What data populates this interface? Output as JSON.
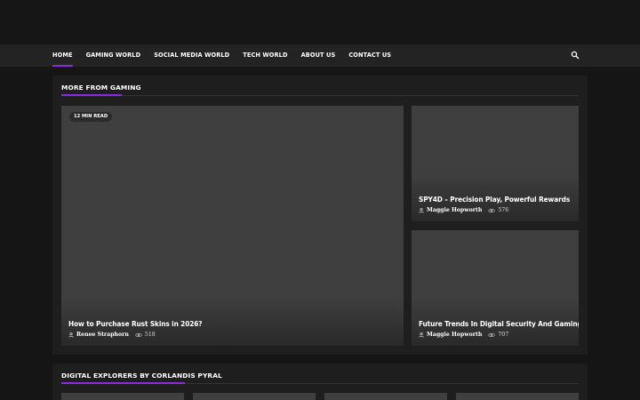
{
  "nav": {
    "items": [
      {
        "label": "HOME",
        "active": true
      },
      {
        "label": "GAMING WORLD",
        "active": false
      },
      {
        "label": "SOCIAL MEDIA WORLD",
        "active": false
      },
      {
        "label": "TECH WORLD",
        "active": false
      },
      {
        "label": "ABOUT US",
        "active": false
      },
      {
        "label": "CONTACT US",
        "active": false
      }
    ],
    "search_icon": "search-icon",
    "accent_color": "#8a2be2"
  },
  "more_from_gaming": {
    "title": "MORE FROM GAMING",
    "featured": {
      "badge": "12 MIN READ",
      "title": "How to Purchase Rust Skins in 2026?",
      "author": "Renee Straphorn",
      "views": "518"
    },
    "side": [
      {
        "title": "SPY4D – Precision Play, Powerful Rewards",
        "author": "Maggie Hopworth",
        "views": "576"
      },
      {
        "title": "Future Trends In Digital Security And Gaming",
        "author": "Maggie Hopworth",
        "views": "707"
      }
    ]
  },
  "digital_explorers": {
    "title": "DIGITAL EXPLORERS BY CORLANDIS PYRAL"
  }
}
